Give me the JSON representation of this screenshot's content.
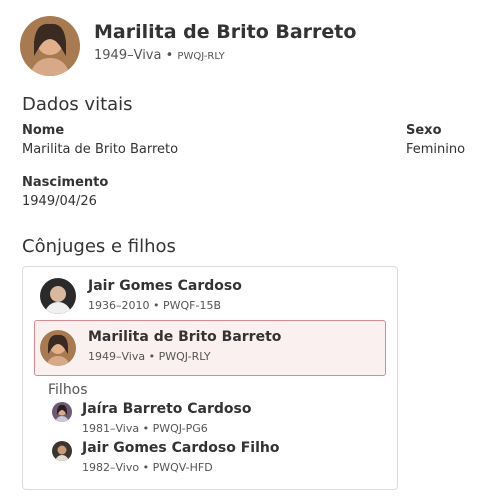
{
  "header": {
    "name": "Marilita de Brito Barreto",
    "lifespan": "1949–Viva",
    "separator": "•",
    "person_id": "PWQJ-RLY"
  },
  "vitals": {
    "title": "Dados vitais",
    "name_label": "Nome",
    "name_value": "Marilita de Brito Barreto",
    "sex_label": "Sexo",
    "sex_value": "Feminino",
    "birth_label": "Nascimento",
    "birth_value": "1949/04/26"
  },
  "family": {
    "title": "Cônjuges e filhos",
    "spouse": {
      "name": "Jair Gomes Cardoso",
      "lifespan": "1936–2010",
      "person_id": "PWQF-15B"
    },
    "self": {
      "name": "Marilita de Brito Barreto",
      "lifespan": "1949–Viva",
      "person_id": "PWQJ-RLY"
    },
    "children_label": "Filhos",
    "children": [
      {
        "name": "Jaíra Barreto Cardoso",
        "lifespan": "1981–Viva",
        "person_id": "PWQJ-PG6"
      },
      {
        "name": "Jair Gomes Cardoso Filho",
        "lifespan": "1982–Vivo",
        "person_id": "PWQV-HFD"
      }
    ]
  },
  "colors": {
    "highlight_border": "#d38b94",
    "highlight_bg": "#fbf0f0",
    "card_border": "#dcdcdc"
  }
}
